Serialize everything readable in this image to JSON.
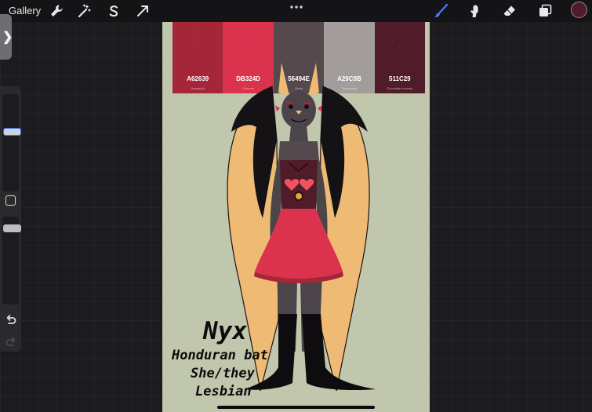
{
  "topbar": {
    "gallery_label": "Gallery",
    "tools_left": [
      {
        "name": "actions",
        "icon": "wrench-icon"
      },
      {
        "name": "adjustments",
        "icon": "magic-wand-icon"
      },
      {
        "name": "selection",
        "icon": "selection-s-icon"
      },
      {
        "name": "transform",
        "icon": "arrow-cursor-icon"
      }
    ],
    "more_icon": "ellipsis-icon",
    "tools_right": [
      {
        "name": "brush",
        "icon": "brush-icon",
        "active": true
      },
      {
        "name": "smudge",
        "icon": "smudge-finger-icon"
      },
      {
        "name": "eraser",
        "icon": "eraser-icon"
      },
      {
        "name": "layers",
        "icon": "layers-icon"
      }
    ],
    "current_color": "#511C29"
  },
  "sidebar": {
    "tab_glyph": "❯",
    "brush_size_level": 0.62,
    "opacity_level": 0.9,
    "undo_icon": "undo-arrow-icon",
    "redo_icon": "redo-arrow-icon"
  },
  "canvas": {
    "background": "#C0C7AC",
    "palette": [
      {
        "hex": "A62639",
        "color": "#A62639",
        "name": "Amaranth"
      },
      {
        "hex": "DB324D",
        "color": "#DB324D",
        "name": "Crimson"
      },
      {
        "hex": "56494E",
        "color": "#56494E",
        "name": "Eerie"
      },
      {
        "hex": "A29C9B",
        "color": "#A29C9B",
        "name": "Taupe grey"
      },
      {
        "hex": "511C29",
        "color": "#511C29",
        "name": "Chocolate cosmos"
      }
    ],
    "caption": {
      "name": "Nyx",
      "species": "Honduran bat",
      "pronouns": "She/they",
      "orientation": "Lesbian"
    }
  },
  "colors": {
    "wing_membrane": "#EFBB74",
    "wing_frame": "#141214",
    "skin": "#4B4549",
    "dress": "#DB324D",
    "dress_dark": "#A62639",
    "bodice": "#511C29",
    "heart": "#F2525E",
    "ear": "#EFBB74"
  }
}
